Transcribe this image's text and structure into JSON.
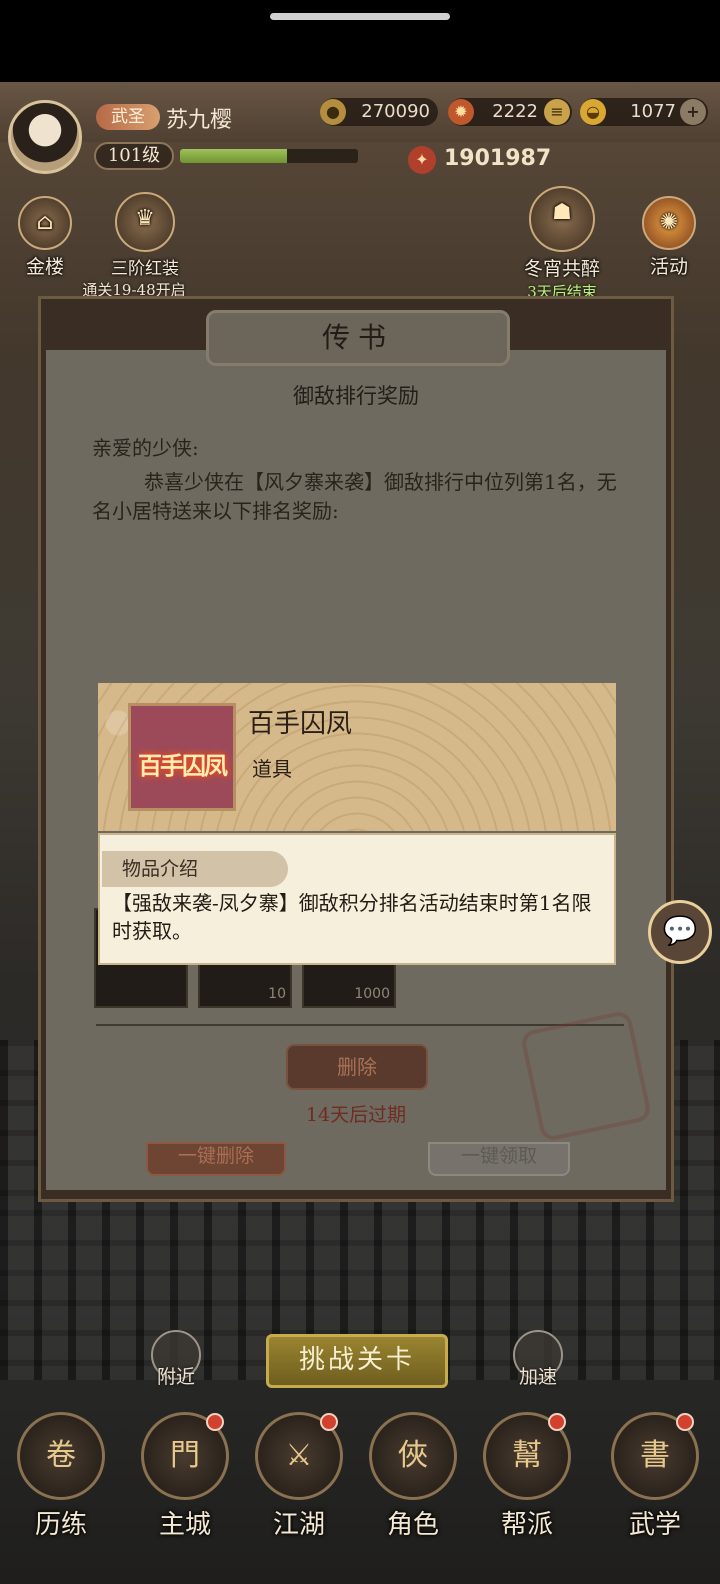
{
  "player": {
    "title": "武圣",
    "name": "苏九樱",
    "level": "101级",
    "exp_fraction": 0.6,
    "power": "1901987"
  },
  "resources": {
    "coins": "270090",
    "second": "2222",
    "gold": "1077"
  },
  "hud_buttons": {
    "left_top": "金楼",
    "outfit": "三阶红装",
    "outfit_sub": "通关19-48开启",
    "event_name": "冬宵共醉",
    "event_sub": "3天后结束",
    "activity": "活动"
  },
  "mail": {
    "window_title": "传书",
    "letter_title": "御敌排行奖励",
    "salutation": "亲爱的少侠:",
    "body": "恭喜少侠在【风夕寨来袭】御敌排行中位列第1名，无名小居特送来以下排名奖励:",
    "reward_counts": [
      "",
      "10",
      "1000"
    ],
    "delete_label": "删除",
    "expiry": "14天后过期",
    "delete_all_label": "一键删除",
    "claim_all_label": "一键领取"
  },
  "item_popup": {
    "name": "百手囚凤",
    "type": "道具",
    "icon_text": "百手囚凤",
    "desc_tab": "物品介绍",
    "description": "【强敌来袭-凤夕寨】御敌积分排名活动结束时第1名限时获取。"
  },
  "actions": {
    "nearby": "附近",
    "challenge": "挑战关卡",
    "speed": "加速"
  },
  "nav": [
    {
      "label": "历练",
      "badge": false
    },
    {
      "label": "主城",
      "badge": true
    },
    {
      "label": "江湖",
      "badge": true
    },
    {
      "label": "角色",
      "badge": false
    },
    {
      "label": "帮派",
      "badge": true
    },
    {
      "label": "武学",
      "badge": true
    }
  ],
  "colors": {
    "accent_gold": "#c7ab4d",
    "badge_red": "#d2402e",
    "expiry_red": "#6f2c22"
  }
}
